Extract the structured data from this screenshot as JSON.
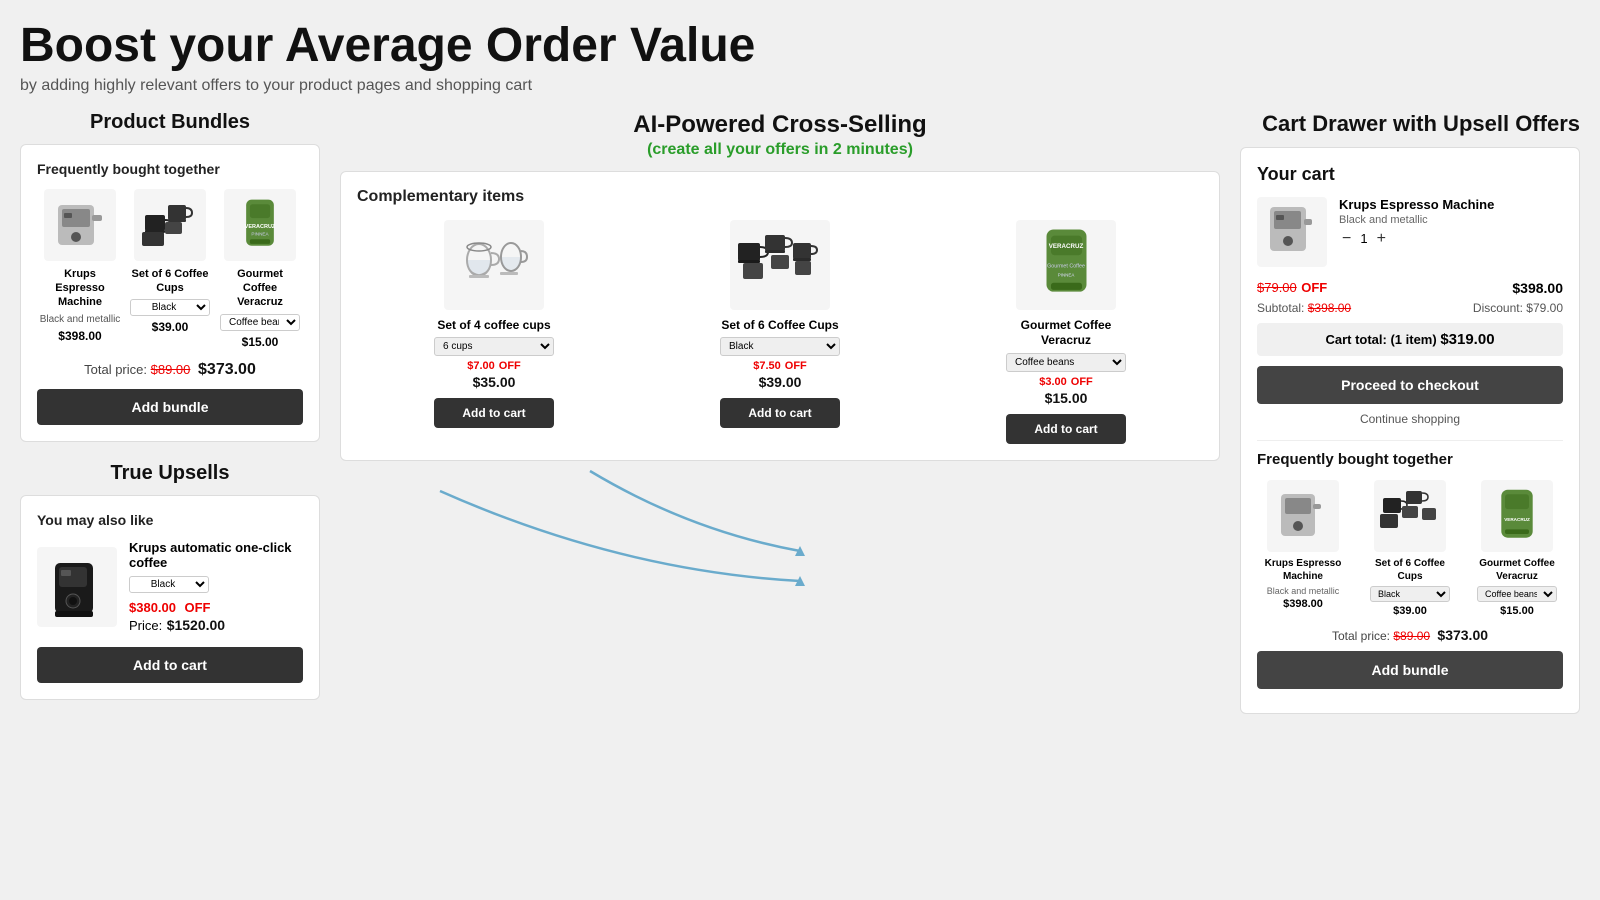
{
  "header": {
    "title": "Boost your Average Order Value",
    "subtitle": "by adding highly relevant offers to your product pages and shopping cart"
  },
  "left_column": {
    "bundles_section_title": "Product Bundles",
    "bundles_card_heading": "Frequently bought together",
    "bundle_products": [
      {
        "name": "Krups Espresso Machine",
        "variant": "Black and metallic",
        "price": "$398.00",
        "has_select": false
      },
      {
        "name": "Set of 6 Coffee Cups",
        "variant": "Black",
        "price": "$39.00",
        "has_select": true,
        "select_value": "Black"
      },
      {
        "name": "Gourmet Coffee Veracruz",
        "variant": "Coffee beans",
        "price": "$15.00",
        "has_select": true,
        "select_value": "Coffee beans"
      }
    ],
    "bundle_total_label": "Total price:",
    "bundle_original_price": "$89.00",
    "bundle_final_price": "$373.00",
    "bundle_btn": "Add bundle",
    "upsells_section_title": "True Upsells",
    "upsells_card_heading": "You may also like",
    "upsell_product_name": "Krups automatic one-click coffee",
    "upsell_variant": "Black",
    "upsell_off_price": "$380.00",
    "upsell_off_label": "OFF",
    "upsell_price_label": "Price:",
    "upsell_final_price": "$1520.00",
    "upsell_btn": "Add to cart"
  },
  "middle_column": {
    "title": "AI-Powered Cross-Selling",
    "subtitle": "(create all your offers in 2 minutes)",
    "card_heading": "Complementary items",
    "products": [
      {
        "name": "Set of 4 coffee cups",
        "select_value": "6 cups",
        "off_price": "$7.00",
        "off_label": "OFF",
        "price": "$35.00",
        "btn": "Add to cart"
      },
      {
        "name": "Set of 6 Coffee Cups",
        "select_value": "Black",
        "off_price": "$7.50",
        "off_label": "OFF",
        "price": "$39.00",
        "btn": "Add to cart"
      },
      {
        "name": "Gourmet Coffee Veracruz",
        "select_value": "Coffee beans",
        "off_price": "$3.00",
        "off_label": "OFF",
        "price": "$15.00",
        "btn": "Add to cart"
      }
    ]
  },
  "right_column": {
    "section_title": "Cart Drawer with Upsell Offers",
    "cart_title": "Your cart",
    "cart_item": {
      "name": "Krups Espresso Machine",
      "variant": "Black and metallic",
      "qty": "1",
      "off_price": "$79.00",
      "off_label": "OFF",
      "final_price": "$398.00"
    },
    "subtotal_label": "Subtotal:",
    "subtotal_value": "$398.00",
    "discount_label": "Discount:",
    "discount_value": "$79.00",
    "cart_total_label": "Cart total: (1 item)",
    "cart_total_value": "$319.00",
    "checkout_btn": "Proceed to checkout",
    "continue_label": "Continue shopping",
    "bundle_section_title": "Frequently bought together",
    "bundle_products": [
      {
        "name": "Krups Espresso Machine",
        "variant_text": "Black and metallic",
        "price": "$398.00",
        "has_select": false
      },
      {
        "name": "Set of 6 Coffee Cups",
        "variant_text": "Black",
        "price": "$39.00",
        "has_select": true,
        "select_value": "Black"
      },
      {
        "name": "Gourmet Coffee Veracruz",
        "variant_text": "Coffee beans",
        "price": "$15.00",
        "has_select": true,
        "select_value": "Coffee beans"
      }
    ],
    "bundle_total_label": "Total price:",
    "bundle_original_price": "$89.00",
    "bundle_final_price": "$373.00",
    "bundle_btn": "Add bundle"
  }
}
